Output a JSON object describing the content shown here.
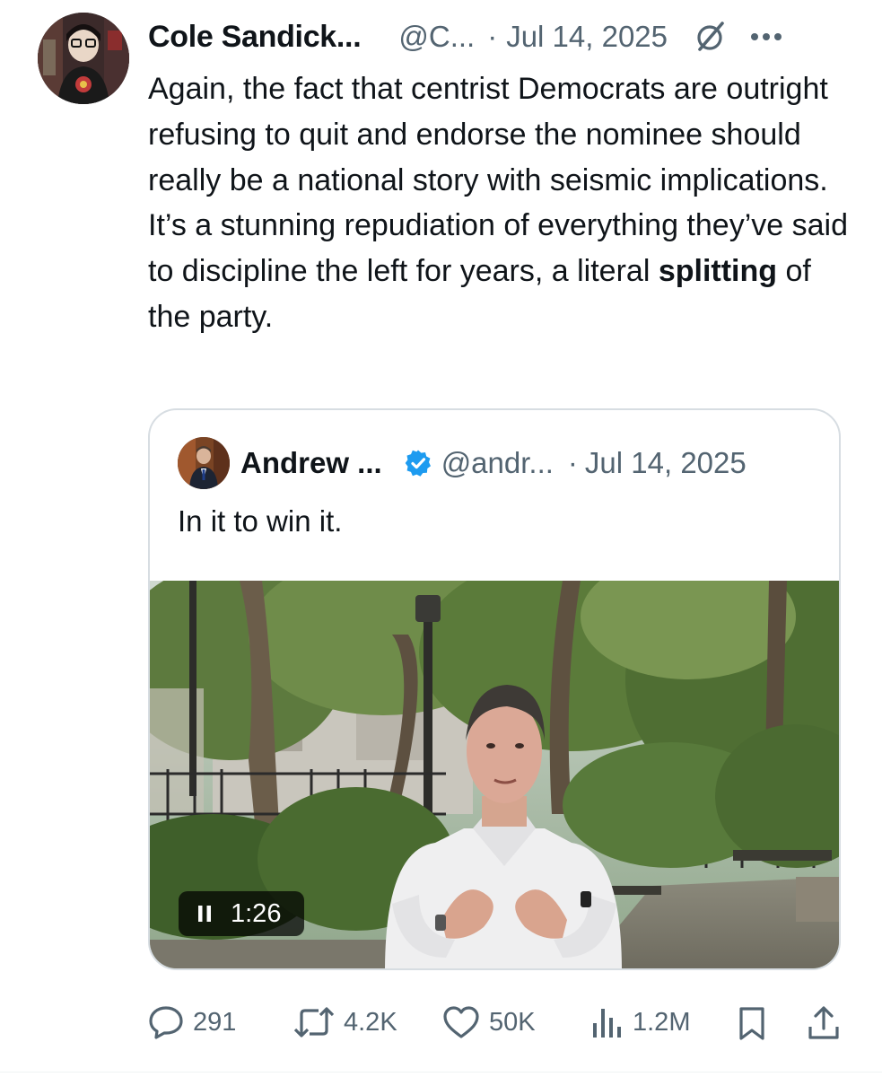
{
  "post": {
    "author_name": "Cole Sandick...",
    "author_handle": "@C...",
    "separator": "·",
    "date": "Jul 14, 2025",
    "text_before_bold": "Again, the fact that centrist Democrats are outright refusing to quit and endorse the nominee should really be a national story with seismic implications. It’s a stunning repudiation of everything they’ve said to discipline the left for years, a literal ",
    "text_bold": "splitting",
    "text_after_bold": " of the party.",
    "icons": {
      "grok": "grok-icon",
      "more": "more-icon"
    }
  },
  "quote": {
    "author_name": "Andrew ...",
    "verified": true,
    "author_handle": "@andr...",
    "separator": "·",
    "date": "Jul 14, 2025",
    "text": "In it to win it.",
    "video": {
      "duration": "1:26",
      "state": "playing",
      "icon": "pause-icon"
    }
  },
  "actions": {
    "replies": "291",
    "reposts": "4.2K",
    "likes": "50K",
    "views": "1.2M",
    "icons": [
      "reply-icon",
      "repost-icon",
      "like-icon",
      "views-icon",
      "bookmark-icon",
      "share-icon"
    ]
  },
  "colors": {
    "text": "#0f1419",
    "secondary": "#536471",
    "border": "#d7dde2",
    "verified": "#1d9bf0"
  }
}
